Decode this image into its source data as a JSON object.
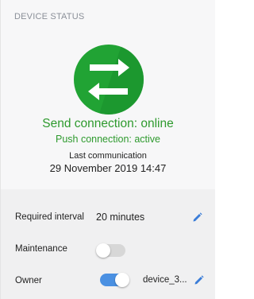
{
  "panel": {
    "title": "DEVICE STATUS"
  },
  "status": {
    "icon": "sync-arrows-icon",
    "color": "#21a334",
    "send_connection": "Send connection: online",
    "push_connection": "Push connection: active",
    "last_communication_label": "Last communication",
    "last_communication_value": "29 November 2019 14:47"
  },
  "details": {
    "required_interval": {
      "label": "Required interval",
      "value": "20 minutes"
    },
    "maintenance": {
      "label": "Maintenance",
      "enabled": false
    },
    "owner": {
      "label": "Owner",
      "enabled": true,
      "value": "device_3..."
    }
  },
  "colors": {
    "accent": "#4a90e2",
    "online_text": "#2e9a2e"
  }
}
